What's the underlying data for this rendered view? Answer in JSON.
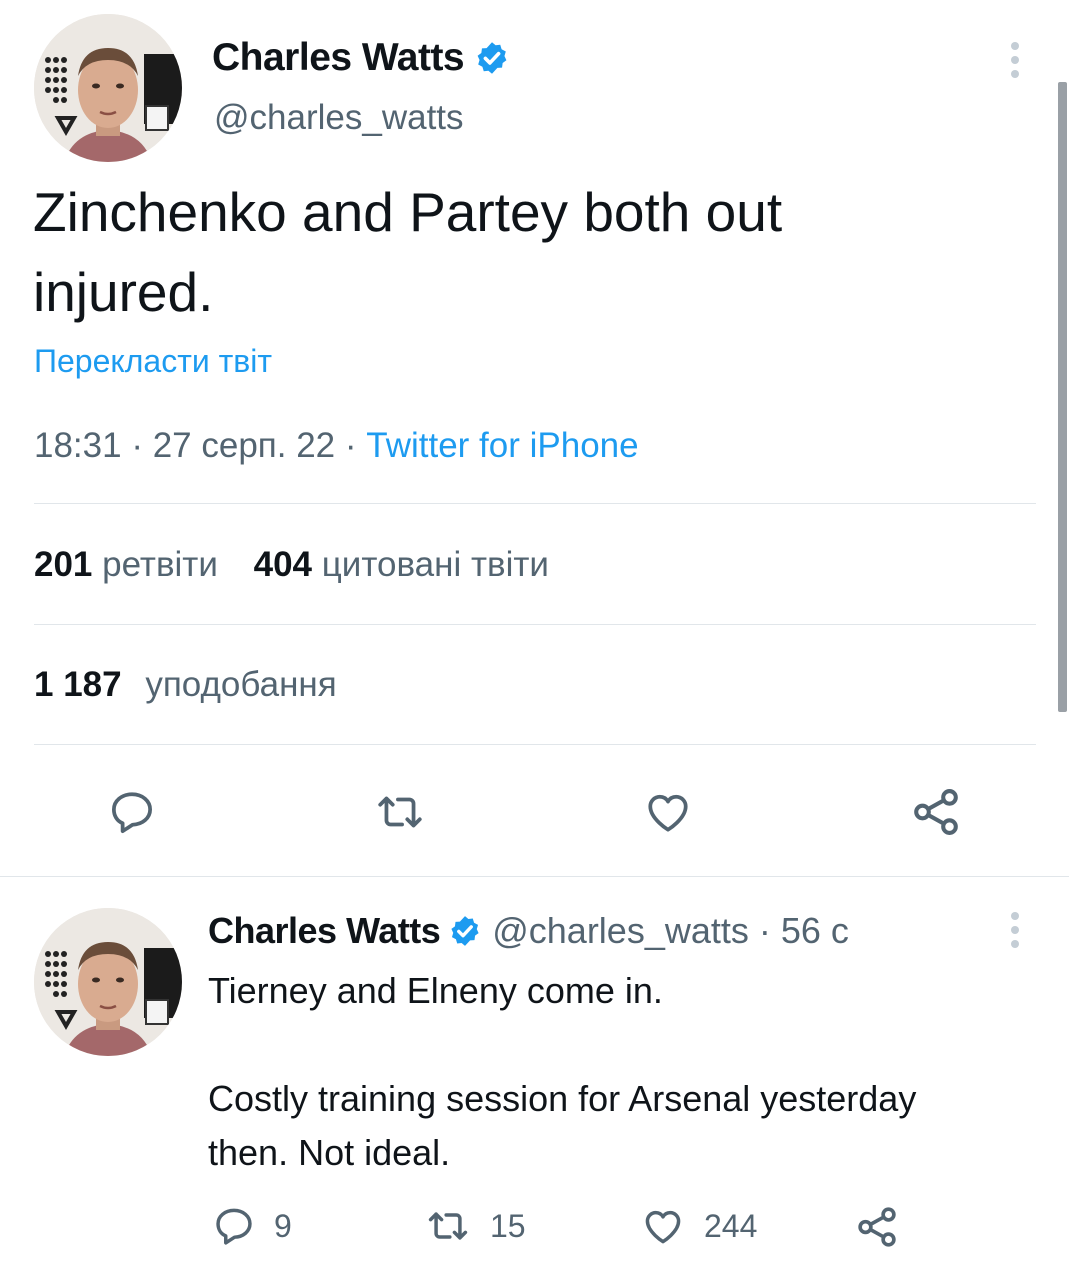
{
  "main_tweet": {
    "author_name": "Charles Watts",
    "handle": "@charles_watts",
    "text_line1": "Zinchenko and Partey both out",
    "text_line2": "injured.",
    "translate_link": "Перекласти твіт",
    "time": "18:31",
    "date": "27 серп. 22",
    "separator": "·",
    "source": "Twitter for iPhone",
    "retweets_count": "201",
    "retweets_label": "ретвіти",
    "quotes_count": "404",
    "quotes_label": "цитовані твіти",
    "likes_count": "1 187",
    "likes_label": "уподобання"
  },
  "reply_tweet": {
    "author_name": "Charles Watts",
    "handle": "@charles_watts",
    "time_sep": "·",
    "time_ago": "56 с",
    "text_para1": "Tierney and Elneny come in.",
    "text_para2_line1": "Costly training session for Arsenal yesterday",
    "text_para2_line2": "then. Not ideal.",
    "reply_count": "9",
    "retweet_count": "15",
    "like_count": "244"
  },
  "colors": {
    "accent": "#1d9bf0",
    "text": "#0f1419",
    "secondary": "#536471",
    "divider": "#e1e6ea"
  },
  "icons": [
    "verified-badge-icon",
    "more-options-icon",
    "reply-icon",
    "retweet-icon",
    "like-icon",
    "share-icon"
  ]
}
